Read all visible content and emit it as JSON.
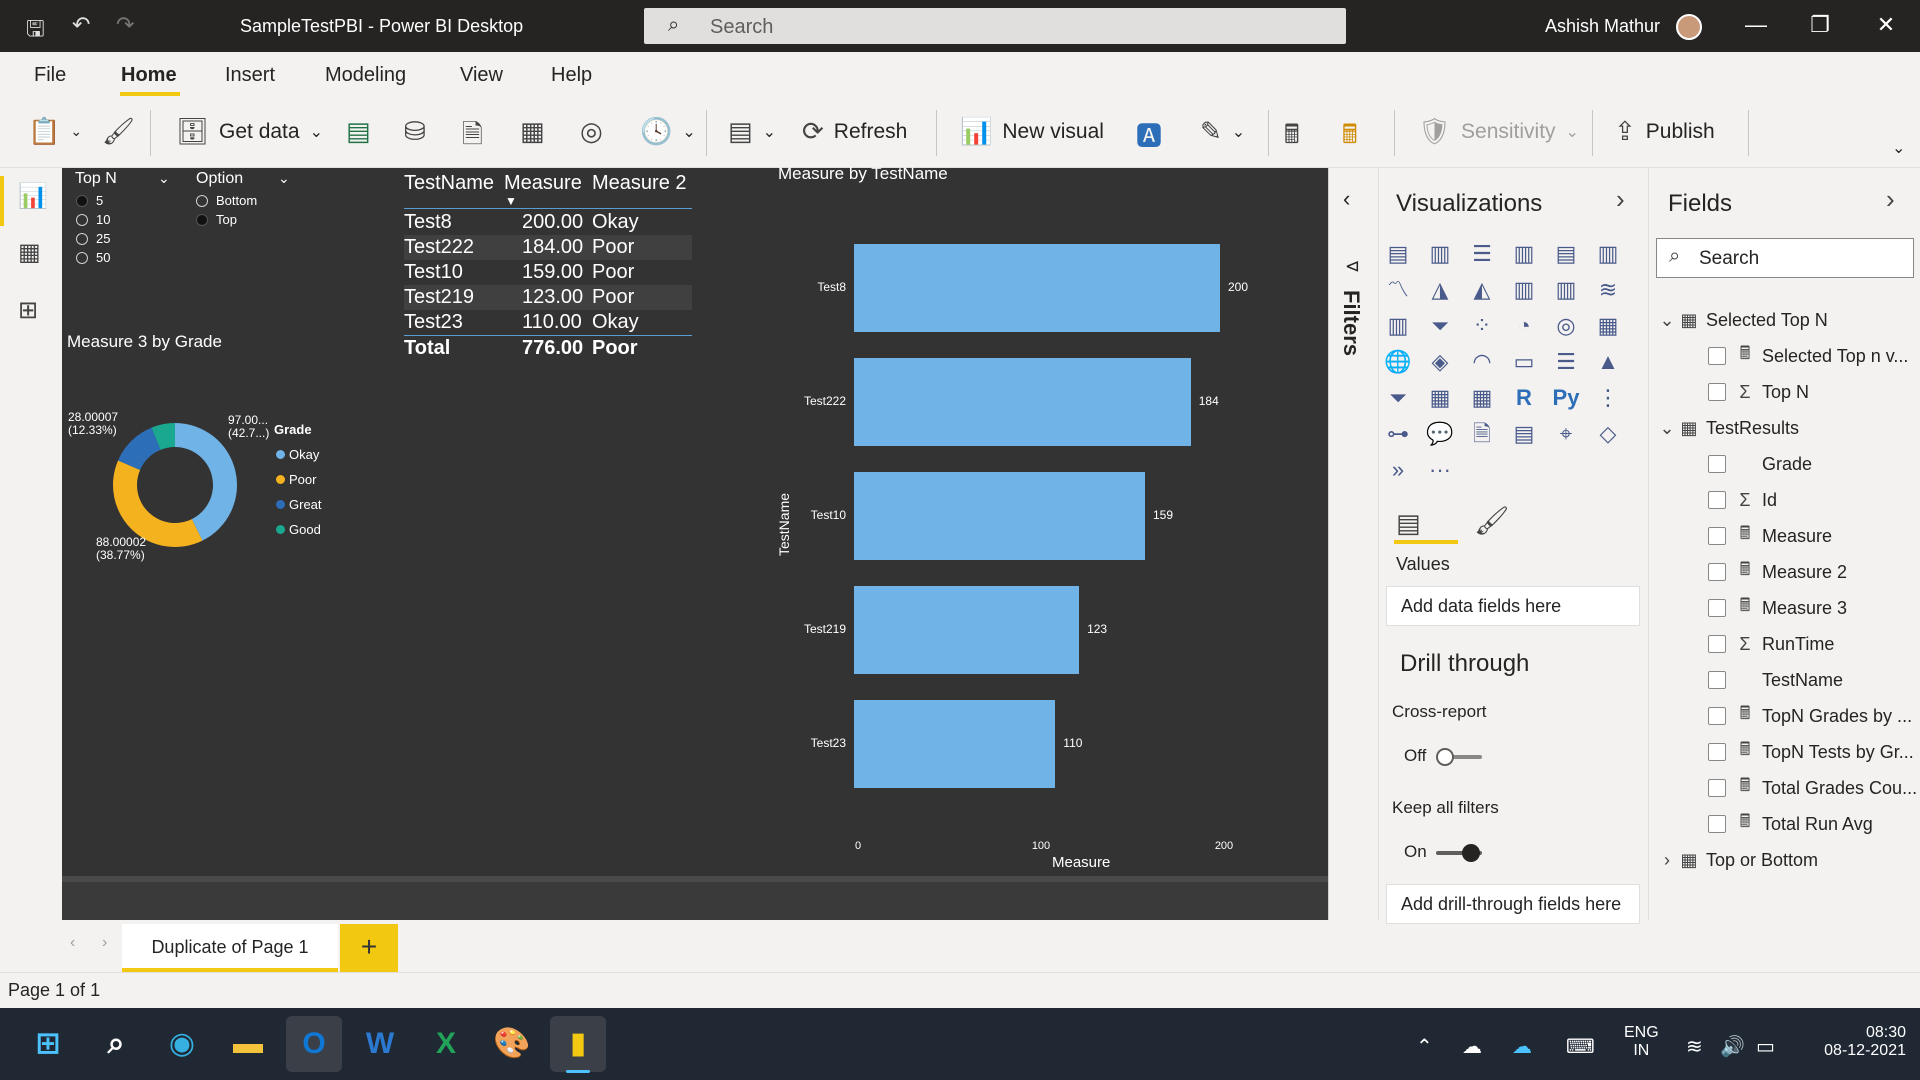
{
  "titlebar": {
    "app_title": "SampleTestPBI - Power BI Desktop",
    "search_placeholder": "Search",
    "user_name": "Ashish Mathur"
  },
  "menu": {
    "items": [
      "File",
      "Home",
      "Insert",
      "Modeling",
      "View",
      "Help"
    ]
  },
  "ribbon": {
    "get_data": "Get data",
    "refresh": "Refresh",
    "new_visual": "New visual",
    "sensitivity": "Sensitivity",
    "publish": "Publish"
  },
  "slicer_topn": {
    "title": "Top N",
    "options": [
      "5",
      "10",
      "25",
      "50"
    ],
    "selected": "5"
  },
  "slicer_option": {
    "title": "Option",
    "options": [
      "Bottom",
      "Top"
    ],
    "selected": "Top"
  },
  "table_visual": {
    "headers": [
      "TestName",
      "Measure",
      "Measure 2"
    ],
    "rows": [
      [
        "Test8",
        "200.00",
        "Okay"
      ],
      [
        "Test222",
        "184.00",
        "Poor"
      ],
      [
        "Test10",
        "159.00",
        "Poor"
      ],
      [
        "Test219",
        "123.00",
        "Poor"
      ],
      [
        "Test23",
        "110.00",
        "Okay"
      ]
    ],
    "total": [
      "Total",
      "776.00",
      "Poor"
    ]
  },
  "bar_chart": {
    "title": "Measure by TestName",
    "xlabel": "Measure",
    "ylabel": "TestName",
    "categories": [
      "Test8",
      "Test222",
      "Test10",
      "Test219",
      "Test23"
    ],
    "values": [
      200,
      184,
      159,
      123,
      110
    ],
    "xlim": [
      0,
      200
    ],
    "ticks": [
      "0",
      "100",
      "200"
    ],
    "color": "#6fb3e7"
  },
  "donut_chart": {
    "title": "Measure 3 by Grade",
    "legend_title": "Grade",
    "legend": [
      {
        "name": "Okay",
        "color": "#6fb3e7"
      },
      {
        "name": "Poor",
        "color": "#f5b21f"
      },
      {
        "name": "Great",
        "color": "#2d6eb8"
      },
      {
        "name": "Good",
        "color": "#1aa890"
      }
    ],
    "label_okay": "97.00...",
    "label_okay_pct": "(42.7...)",
    "label_poor": "88.00002",
    "label_poor_pct": "(38.77%)",
    "label_great": "28.00007",
    "label_great_pct": "(12.33%)"
  },
  "filters_pane": {
    "label": "Filters"
  },
  "visualizations_pane": {
    "title": "Visualizations",
    "values_label": "Values",
    "add_data_fields": "Add data fields here",
    "drill_through": "Drill through",
    "cross_report": "Cross-report",
    "cross_report_state": "Off",
    "keep_all_filters": "Keep all filters",
    "keep_all_filters_state": "On",
    "add_drill_fields": "Add drill-through fields here",
    "more": "···"
  },
  "fields_pane": {
    "title": "Fields",
    "search_placeholder": "Search",
    "tables": [
      {
        "name": "Selected Top N",
        "fields": [
          "Selected Top n v...",
          "Top N"
        ]
      },
      {
        "name": "TestResults",
        "fields": [
          "Grade",
          "Id",
          "Measure",
          "Measure 2",
          "Measure 3",
          "RunTime",
          "TestName",
          "TopN Grades by ...",
          "TopN Tests by Gr...",
          "Total Grades Cou...",
          "Total Run Avg"
        ]
      },
      {
        "name": "Top or Bottom",
        "fields": []
      }
    ]
  },
  "page_tabs": {
    "active": "Duplicate of Page 1",
    "add": "+"
  },
  "status": {
    "page": "Page 1 of 1"
  },
  "taskbar": {
    "lang": "ENG",
    "region": "IN",
    "time": "08:30",
    "date": "08-12-2021"
  }
}
